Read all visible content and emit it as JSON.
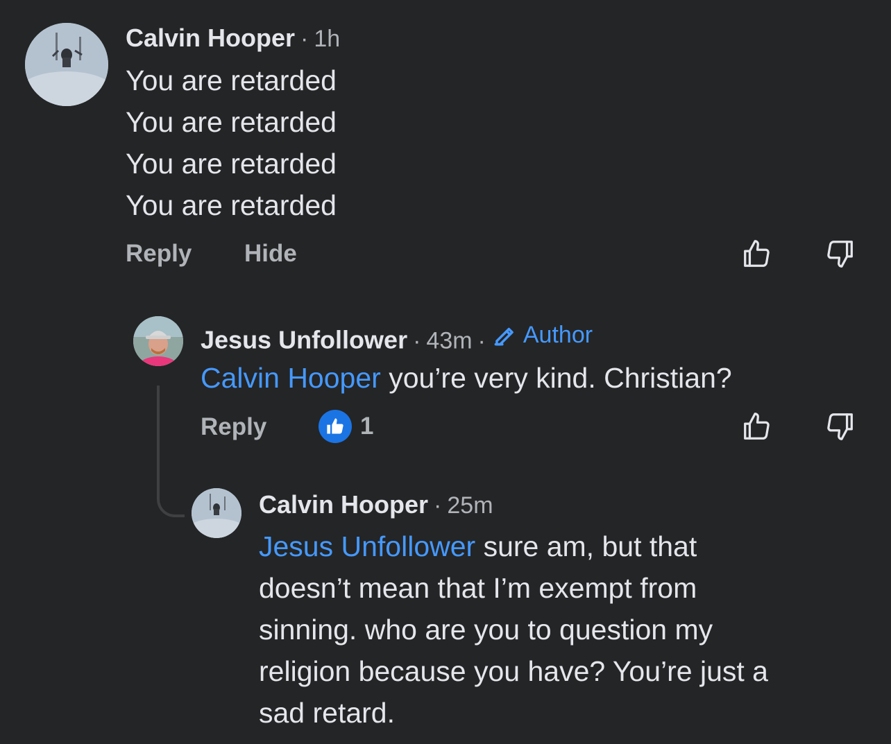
{
  "comments": [
    {
      "author": "Calvin Hooper",
      "time": "1h",
      "lines": [
        "You are retarded",
        "You are retarded",
        "You are retarded",
        "You are retarded"
      ],
      "actions": {
        "reply": "Reply",
        "hide": "Hide"
      }
    },
    {
      "author": "Jesus Unfollower",
      "time": "43m",
      "badge": "Author",
      "mention": "Calvin Hooper",
      "text": "you’re very kind. Christian?",
      "actions": {
        "reply": "Reply"
      },
      "reaction": {
        "icon": "like-icon",
        "count": "1"
      }
    },
    {
      "author": "Calvin Hooper",
      "time": "25m",
      "mention": "Jesus Unfollower",
      "lines": [
        " sure am, but that",
        "doesn’t mean that I’m exempt from",
        "sinning. who are you to question my",
        "religion because you have? You’re just a",
        "sad retard."
      ]
    }
  ],
  "separator": "·",
  "icons": [
    "thumbs-up-icon",
    "thumbs-down-icon",
    "pencil-icon",
    "like-icon"
  ],
  "colors": {
    "background": "#242526",
    "text": "#e4e6eb",
    "secondary": "#b0b3b8",
    "link": "#4599ff",
    "like": "#1b74e4"
  }
}
